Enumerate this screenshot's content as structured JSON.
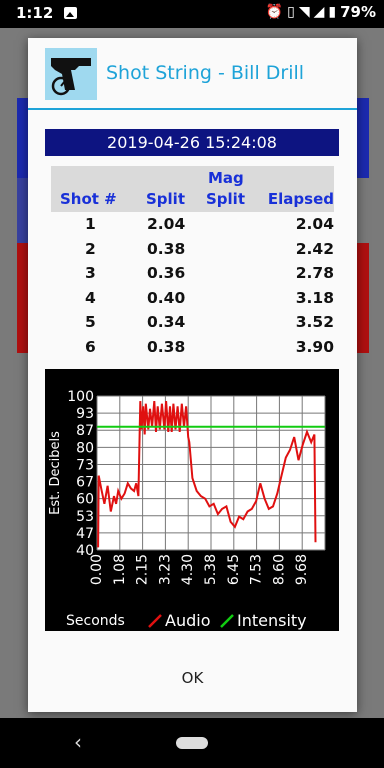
{
  "status_bar": {
    "time": "1:12",
    "battery": "79%",
    "icons": [
      "gallery-icon",
      "alarm-icon",
      "vibrate-icon",
      "wifi-icon",
      "signal-icon",
      "battery-icon"
    ]
  },
  "dialog": {
    "title": "Shot String - Bill Drill",
    "date": "2019-04-26 15:24:08",
    "ok_label": "OK"
  },
  "table": {
    "headers": {
      "shot": "Shot #",
      "split": "Split",
      "mag_top": "Mag",
      "mag_bottom": "Split",
      "elapsed": "Elapsed"
    },
    "rows": [
      {
        "shot": "1",
        "split": "2.04",
        "elapsed": "2.04"
      },
      {
        "shot": "2",
        "split": "0.38",
        "elapsed": "2.42"
      },
      {
        "shot": "3",
        "split": "0.36",
        "elapsed": "2.78"
      },
      {
        "shot": "4",
        "split": "0.40",
        "elapsed": "3.18"
      },
      {
        "shot": "5",
        "split": "0.34",
        "elapsed": "3.52"
      },
      {
        "shot": "6",
        "split": "0.38",
        "elapsed": "3.90"
      }
    ]
  },
  "chart_data": {
    "type": "line",
    "ylabel": "Est. Decibels",
    "xlabel": "Seconds",
    "y_ticks": [
      "100",
      "93",
      "87",
      "80",
      "73",
      "67",
      "60",
      "53",
      "47",
      "40"
    ],
    "x_ticks": [
      "0.00",
      "1.08",
      "2.15",
      "3.23",
      "4.30",
      "5.38",
      "6.45",
      "7.53",
      "8.60",
      "9.68"
    ],
    "ylim": [
      40,
      100
    ],
    "xlim": [
      0,
      10.75
    ],
    "grid": true,
    "legend_position": "bottom",
    "series": [
      {
        "name": "Audio",
        "color": "#e01010",
        "x": [
          0.05,
          0.08,
          0.2,
          0.35,
          0.5,
          0.65,
          0.8,
          0.9,
          1.0,
          1.15,
          1.3,
          1.45,
          1.6,
          1.75,
          1.85,
          1.95,
          2.04,
          2.1,
          2.18,
          2.25,
          2.3,
          2.42,
          2.5,
          2.6,
          2.7,
          2.78,
          2.86,
          2.96,
          3.06,
          3.18,
          3.26,
          3.36,
          3.44,
          3.52,
          3.6,
          3.7,
          3.8,
          3.9,
          4.0,
          4.1,
          4.2,
          4.3,
          4.35,
          4.5,
          4.7,
          4.9,
          5.1,
          5.3,
          5.5,
          5.7,
          5.9,
          6.1,
          6.3,
          6.5,
          6.7,
          6.9,
          7.1,
          7.3,
          7.5,
          7.7,
          7.9,
          8.1,
          8.3,
          8.5,
          8.7,
          8.9,
          9.1,
          9.3,
          9.5,
          9.7,
          9.9,
          10.1,
          10.25,
          10.3
        ],
        "y": [
          41,
          69,
          64,
          58,
          65,
          55,
          61,
          58,
          63,
          60,
          62,
          66,
          64,
          63,
          66,
          61,
          98,
          87,
          96,
          85,
          97,
          87,
          95,
          88,
          98,
          86,
          96,
          87,
          97,
          87,
          98,
          86,
          96,
          86,
          97,
          87,
          96,
          86,
          97,
          88,
          96,
          84,
          82,
          68,
          63,
          61,
          60,
          57,
          58,
          54,
          56,
          57,
          51,
          49,
          53,
          52,
          55,
          56,
          59,
          66,
          60,
          56,
          57,
          62,
          69,
          76,
          79,
          84,
          75,
          81,
          86,
          82,
          85,
          43
        ]
      },
      {
        "name": "Intensity",
        "color": "#11cc11",
        "x": [
          0,
          10.75
        ],
        "y": [
          88,
          88
        ]
      }
    ]
  }
}
